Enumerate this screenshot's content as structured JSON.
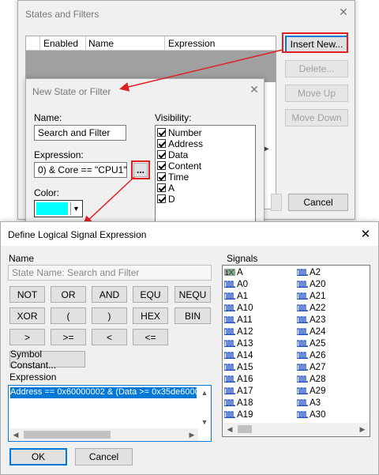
{
  "states_window": {
    "title": "States and Filters",
    "columns": [
      "Enabled",
      "Name",
      "Expression"
    ],
    "insert_new": "Insert New...",
    "delete": "Delete...",
    "move_up": "Move Up",
    "move_down": "Move Down",
    "cancel": "Cancel"
  },
  "new_state_window": {
    "title": "New State or Filter",
    "name_label": "Name:",
    "name_value": "Search and Filter",
    "expression_label": "Expression:",
    "expression_value": "0)  & Core == \"CPU1\"",
    "browse": "...",
    "color_label": "Color:",
    "color_value": "#00ffff",
    "visibility_label": "Visibility:",
    "visibility_items": [
      "Number",
      "Address",
      "Data",
      "Content",
      "Time",
      "A",
      "D"
    ]
  },
  "define_window": {
    "title": "Define Logical Signal Expression",
    "close": "✕",
    "name_label": "Name",
    "name_placeholder": "State Name: Search and Filter",
    "buttons_row1": [
      "NOT",
      "OR",
      "AND",
      "EQU",
      "NEQU"
    ],
    "buttons_row2": [
      "XOR",
      "(",
      ")",
      "HEX",
      "BIN"
    ],
    "buttons_row3": [
      ">",
      ">=",
      "<",
      "<="
    ],
    "symbol_constant": "Symbol Constant...",
    "expression_label": "Expression",
    "expression_value": "Address == 0x60000002 & (Data  >=  0x35de6000",
    "signals_label": "Signals",
    "signals_col1": [
      "A",
      "A0",
      "A1",
      "A10",
      "A11",
      "A12",
      "A13",
      "A14",
      "A15",
      "A16",
      "A17",
      "A18",
      "A19"
    ],
    "signals_col2": [
      "A2",
      "A20",
      "A21",
      "A22",
      "A23",
      "A24",
      "A25",
      "A26",
      "A27",
      "A28",
      "A29",
      "A3",
      "A30"
    ],
    "ok": "OK",
    "cancel": "Cancel"
  },
  "colors": {
    "highlight_red": "#e02020",
    "selection_blue": "#0078d7",
    "signal_icon_blue": "#1f4fbf"
  }
}
